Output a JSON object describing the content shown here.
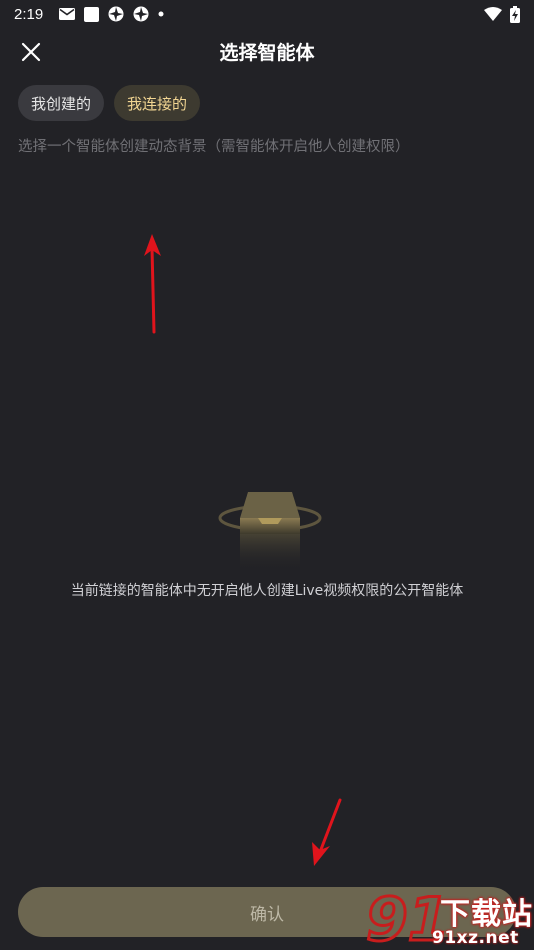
{
  "status_bar": {
    "time": "2:19",
    "icons_left": [
      "mail-icon",
      "square-app-icon",
      "aperture-icon",
      "aperture-icon",
      "dot-icon"
    ],
    "icons_right": [
      "wifi-icon",
      "battery-charging-icon"
    ]
  },
  "header": {
    "title": "选择智能体",
    "close_icon": "close-icon"
  },
  "tabs": [
    {
      "label": "我创建的",
      "active": false
    },
    {
      "label": "我连接的",
      "active": true
    }
  ],
  "hint": "选择一个智能体创建动态背景（需智能体开启他人创建权限）",
  "empty_state": {
    "icon": "empty-box-icon",
    "message": "当前链接的智能体中无开启他人创建Live视频权限的公开智能体"
  },
  "footer": {
    "confirm_label": "确认"
  },
  "annotations": {
    "arrow_color": "#e0141c"
  },
  "watermark": {
    "brand": "下载站",
    "site": "91xz.net",
    "logo_text": "91"
  },
  "colors": {
    "background": "#222226",
    "tab_bg": "#3a3a3f",
    "tab_active_text": "#f1d592",
    "confirm_bg": "#6c6650"
  }
}
